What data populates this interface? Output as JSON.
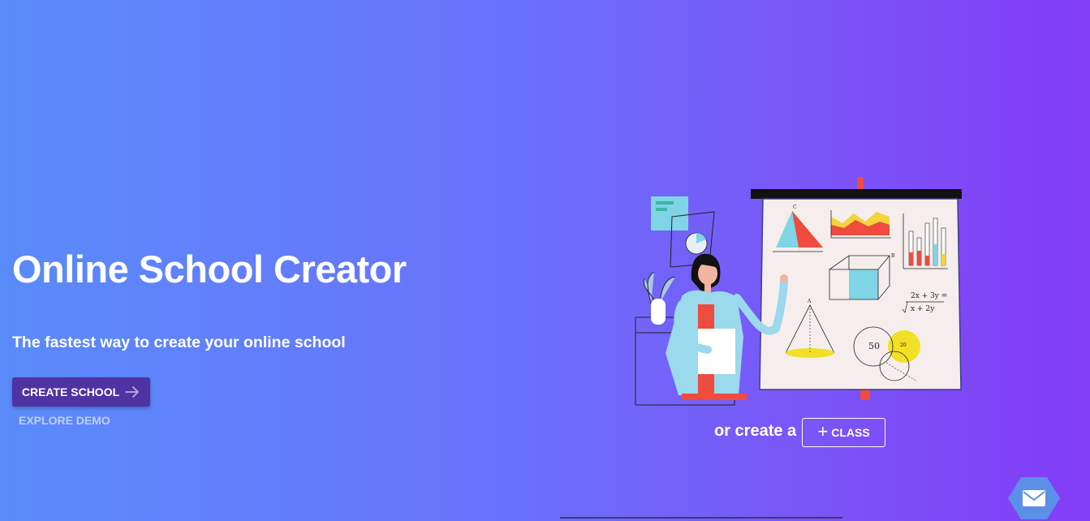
{
  "hero": {
    "title": "Online School Creator",
    "subtitle": "The fastest way to create your online school",
    "create_button_label": "CREATE SCHOOL",
    "explore_link_label": "EXPLORE DEMO"
  },
  "secondary": {
    "or_create_text": "or create a",
    "class_button_label": "CLASS"
  },
  "illustration": {
    "equation_line1": "2x + 3y =",
    "equation_line2": "x + 2y",
    "venn_left": "50",
    "venn_right": "20",
    "label_a": "A",
    "label_b": "B",
    "label_c": "C"
  },
  "icons": {
    "create_arrow": "arrow-right-icon",
    "class_plus": "plus-icon",
    "mail": "mail-icon"
  },
  "colors": {
    "gradient_start": "#5a8bf9",
    "gradient_end": "#823cf6",
    "primary_button": "#4f33a3",
    "mail_fab": "#5b8fe8"
  }
}
